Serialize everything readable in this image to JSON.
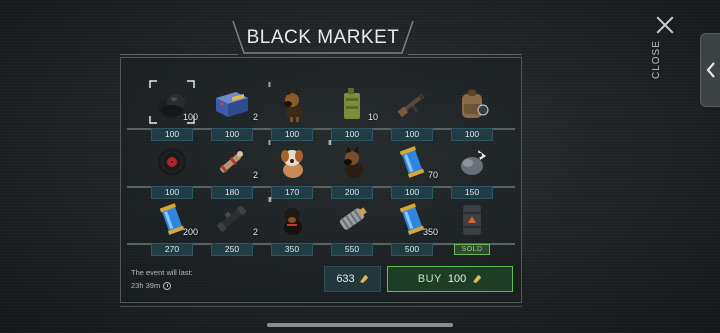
{
  "title": "BLACK MARKET",
  "close_label": "CLOSE",
  "timer": {
    "label": "The event will last:",
    "value": "23h 39m"
  },
  "balance": "633",
  "buy": {
    "label": "BUY",
    "price": "100"
  },
  "rows": [
    [
      {
        "name": "black-coal-item",
        "qty": "100",
        "tier": "",
        "price": "100"
      },
      {
        "name": "ammo-box-item",
        "qty": "2",
        "tier": "",
        "price": "100"
      },
      {
        "name": "shepherd-dog-item",
        "qty": "",
        "tier": "II",
        "price": "100"
      },
      {
        "name": "fuel-canister-item",
        "qty": "10",
        "tier": "",
        "price": "100"
      },
      {
        "name": "rifle-item",
        "qty": "",
        "tier": "",
        "price": "100"
      },
      {
        "name": "backpack-item",
        "qty": "",
        "tier": "",
        "price": "100"
      }
    ],
    [
      {
        "name": "vinyl-record-item",
        "qty": "",
        "tier": "",
        "price": "100"
      },
      {
        "name": "hunting-gear-item",
        "qty": "2",
        "tier": "",
        "price": "180"
      },
      {
        "name": "saint-bernard-dog-item",
        "qty": "",
        "tier": "II",
        "price": "170"
      },
      {
        "name": "shepherd-dog-item",
        "qty": "",
        "tier": "III",
        "price": "200"
      },
      {
        "name": "blue-capsule-item",
        "qty": "70",
        "tier": "",
        "price": "100"
      },
      {
        "name": "scrap-bundle-item",
        "qty": "",
        "tier": "",
        "price": "150"
      }
    ],
    [
      {
        "name": "blue-capsule-item",
        "qty": "200",
        "tier": "",
        "price": "270"
      },
      {
        "name": "scope-item",
        "qty": "2",
        "tier": "",
        "price": "250"
      },
      {
        "name": "rottweiler-dog-item",
        "qty": "",
        "tier": "III",
        "price": "350"
      },
      {
        "name": "metal-spring-item",
        "qty": "",
        "tier": "",
        "price": "550"
      },
      {
        "name": "blue-capsule-item",
        "qty": "350",
        "tier": "",
        "price": "500"
      },
      {
        "name": "supply-crate-item",
        "qty": "",
        "tier": "",
        "price": "",
        "sold": "SOLD"
      }
    ]
  ]
}
